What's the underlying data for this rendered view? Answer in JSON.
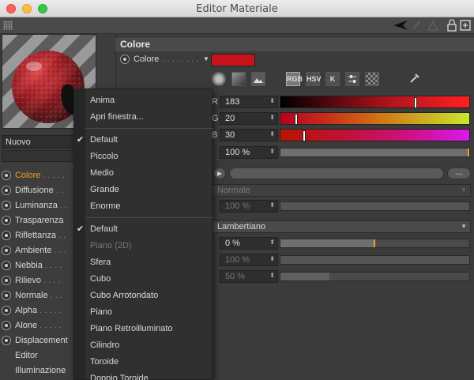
{
  "window": {
    "title": "Editor Materiale"
  },
  "left": {
    "preset": "Nuovo",
    "channels": [
      {
        "label": "Colore",
        "dots": ". . . . .",
        "active": true,
        "radio": true
      },
      {
        "label": "Diffusione",
        "dots": ". .",
        "active": false,
        "radio": true
      },
      {
        "label": "Luminanza",
        "dots": ". .",
        "active": false,
        "radio": true
      },
      {
        "label": "Trasparenza",
        "dots": "",
        "active": false,
        "radio": true
      },
      {
        "label": "Riflettanza",
        "dots": ". .",
        "active": false,
        "radio": true
      },
      {
        "label": "Ambiente",
        "dots": ". . .",
        "active": false,
        "radio": true
      },
      {
        "label": "Nebbia",
        "dots": ". . . .",
        "active": false,
        "radio": true
      },
      {
        "label": "Rilievo",
        "dots": ". . . .",
        "active": false,
        "radio": true
      },
      {
        "label": "Normale",
        "dots": ". . .",
        "active": false,
        "radio": true
      },
      {
        "label": "Alpha",
        "dots": ". . . . .",
        "active": false,
        "radio": true
      },
      {
        "label": "Alone",
        "dots": ". . . . .",
        "active": false,
        "radio": true
      },
      {
        "label": "Displacement",
        "dots": "",
        "active": false,
        "radio": true
      },
      {
        "label": "Editor",
        "dots": "",
        "active": false,
        "radio": false
      },
      {
        "label": "Illuminazione",
        "dots": "",
        "active": false,
        "radio": false
      }
    ]
  },
  "section": {
    "title": "Colore",
    "field_label": "Colore",
    "field_dots": ". . . . . . . .",
    "swatch_color": "#c8121c",
    "modes": [
      "RGB",
      "HSV",
      "K"
    ],
    "r": {
      "label": "R",
      "value": "183",
      "fraction": 0.718
    },
    "g": {
      "label": "G",
      "value": "20",
      "fraction": 0.078
    },
    "b": {
      "label": "B",
      "value": "30",
      "fraction": 0.118
    },
    "brightness": {
      "value": "100 %",
      "fraction": 1.0
    },
    "mix_mode": "Normale",
    "mix_strength": "100 %",
    "model": "Lambertiano",
    "diffuse_falloff": {
      "value": "0 %",
      "fraction": 0.5
    },
    "diffuse_level": "100 %",
    "roughness": "50 %"
  },
  "menu": {
    "group1": [
      "Anima",
      "Apri finestra..."
    ],
    "group2": [
      "Default",
      "Piccolo",
      "Medio",
      "Grande",
      "Enorme"
    ],
    "group2_checked": "Default",
    "group3": [
      "Default",
      "Piano (2D)",
      "Sfera",
      "Cubo",
      "Cubo Arrotondato",
      "Piano",
      "Piano Retroilluminato",
      "Cilindro",
      "Toroide",
      "Doppio Toroide"
    ],
    "group3_checked": "Default",
    "group3_disabled": "Piano (2D)"
  }
}
